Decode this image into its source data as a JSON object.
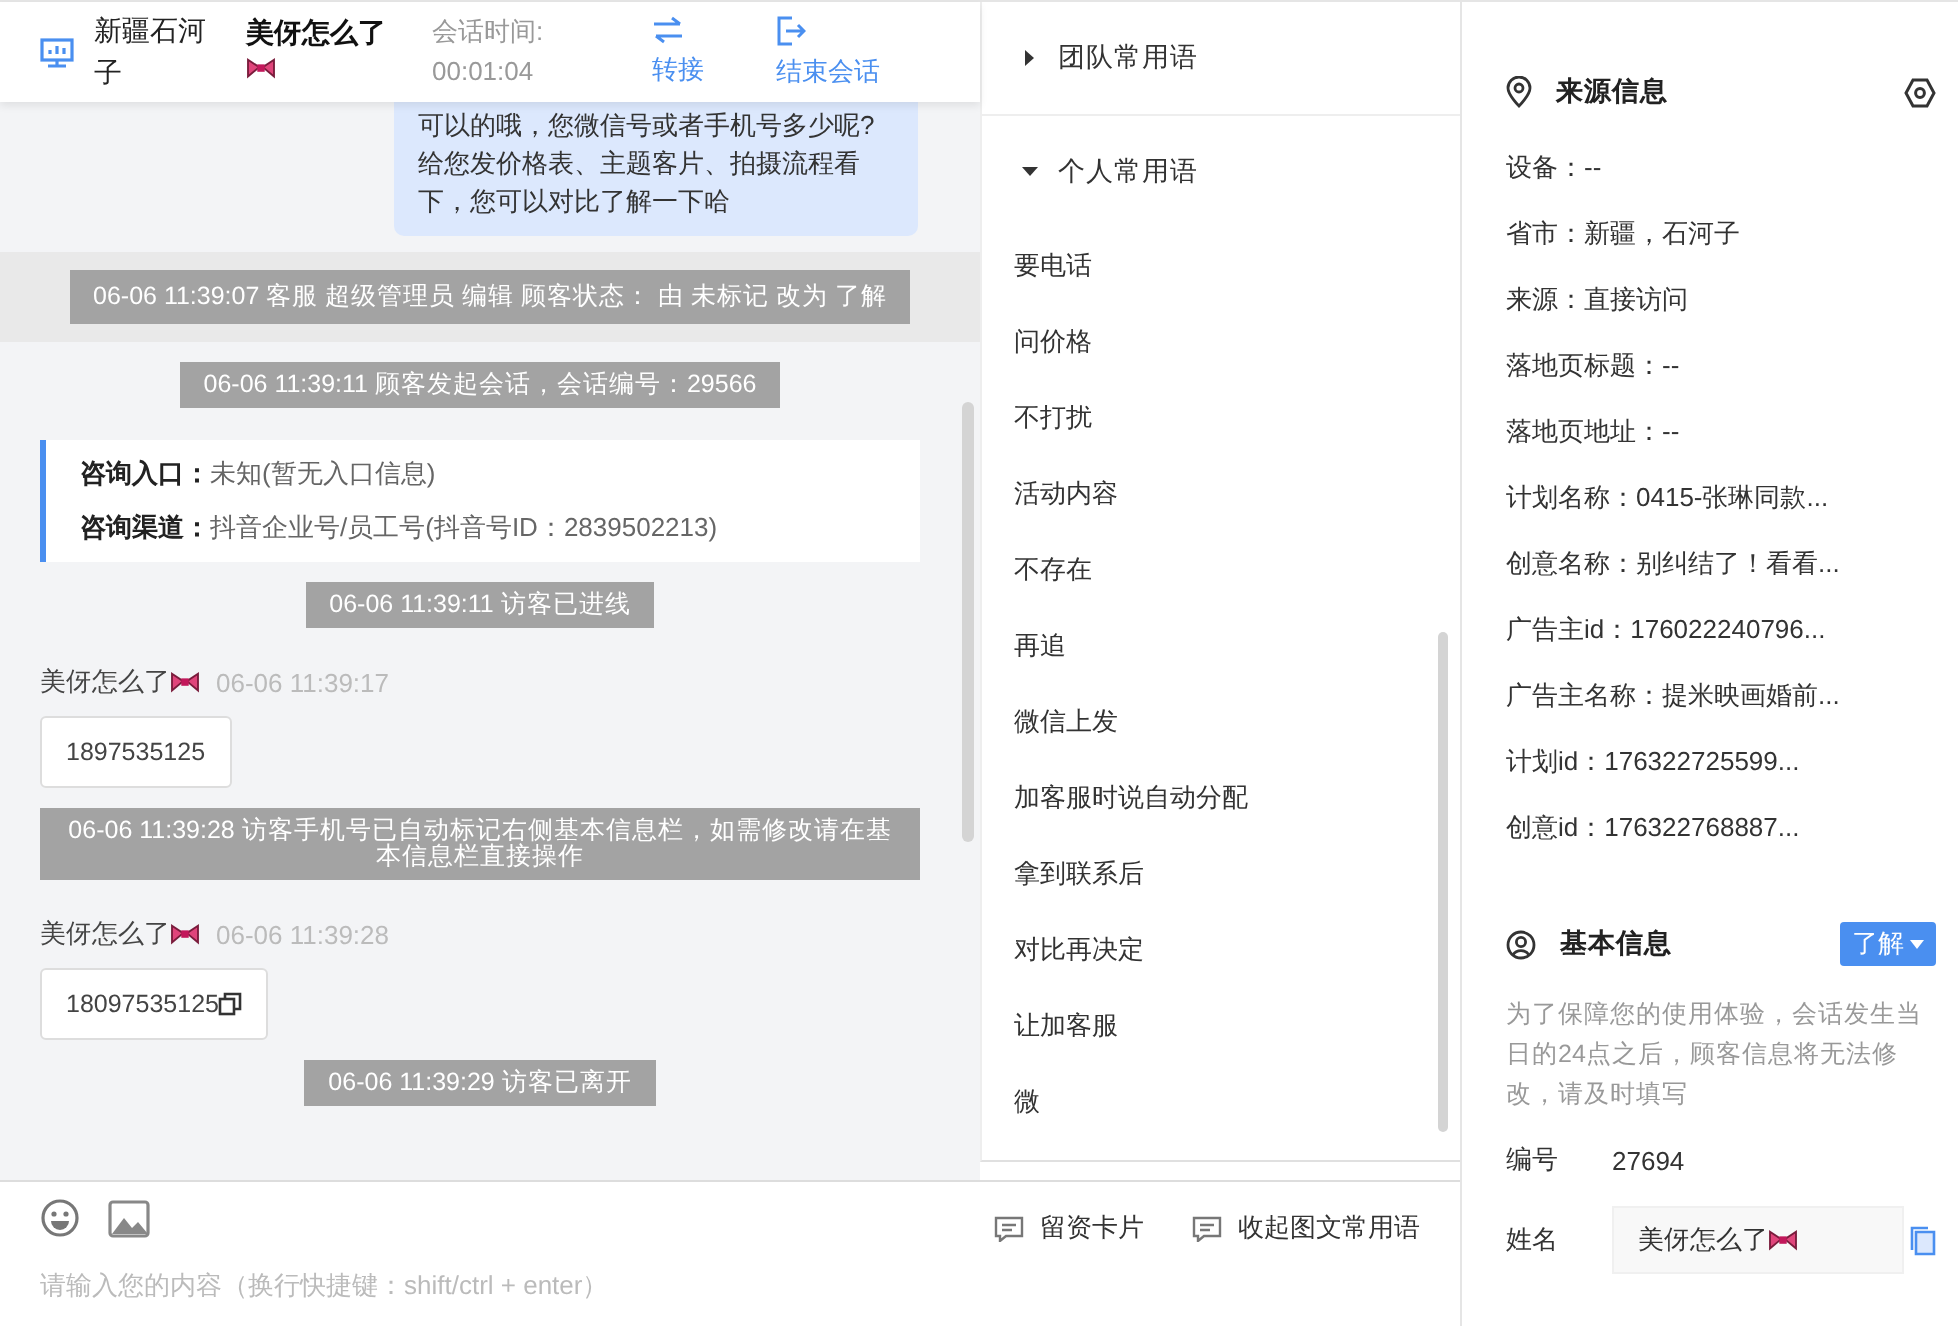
{
  "header": {
    "location": "新疆石河子",
    "visitor_name": "美伢怎么了",
    "session_time_label": "会话时间:",
    "session_time": "00:01:04",
    "actions": [
      {
        "kind": "transfer",
        "label": "转接"
      },
      {
        "kind": "end",
        "label": "结束会话"
      }
    ]
  },
  "messages": [
    {
      "kind": "agent",
      "text": "可以的哦，您微信号或者手机号多少呢?给您发价格表、主题客片、拍摄流程看下，您可以对比了解一下哈"
    },
    {
      "kind": "system",
      "text": "06-06 11:39:07 客服 超级管理员 编辑 顾客状态： 由 未标记 改为 了解",
      "highlighted": true
    },
    {
      "kind": "system",
      "text": "06-06 11:39:11 顾客发起会话，会话编号：29566",
      "highlighted": false
    },
    {
      "kind": "info",
      "rows": [
        {
          "label": "咨询入口：",
          "value": "未知(暂无入口信息)"
        },
        {
          "label": "咨询渠道：",
          "value": "抖音企业号/员工号(抖音号ID：2839502213)"
        }
      ]
    },
    {
      "kind": "system",
      "text": "06-06 11:39:11 访客已进线",
      "highlighted": false
    },
    {
      "kind": "visitor",
      "name": "美伢怎么了",
      "time": "06-06 11:39:17",
      "text": "1897535125",
      "copyable": false
    },
    {
      "kind": "system",
      "text": "06-06 11:39:28 访客手机号已自动标记右侧基本信息栏，如需修改请在基本信息栏直接操作",
      "highlighted": false
    },
    {
      "kind": "visitor",
      "name": "美伢怎么了",
      "time": "06-06 11:39:28",
      "text": "18097535125",
      "copyable": true
    },
    {
      "kind": "system",
      "text": "06-06 11:39:29 访客已离开",
      "highlighted": false
    }
  ],
  "input": {
    "placeholder": "请输入您的内容（换行快捷键：shift/ctrl + enter）"
  },
  "toolbar_actions": [
    "留资卡片",
    "收起图文常用语"
  ],
  "phrases": {
    "groups": [
      {
        "title": "团队常用语",
        "expanded": false
      },
      {
        "title": "个人常用语",
        "expanded": true
      }
    ],
    "items": [
      "要电话",
      "问价格",
      "不打扰",
      "活动内容",
      "不存在",
      "再追",
      "微信上发",
      "加客服时说自动分配",
      "拿到联系后",
      "对比再决定",
      "让加客服",
      "微"
    ]
  },
  "source_info": {
    "title": "来源信息",
    "rows": [
      "设备：--",
      "省市：新疆，石河子",
      "来源：直接访问",
      "落地页标题：--",
      "落地页地址：--",
      "计划名称：0415-张琳同款...",
      "创意名称：别纠结了！看看...",
      "广告主id：176022240796...",
      "广告主名称：提米映画婚前...",
      "计划id：176322725599...",
      "创意id：176322768887..."
    ]
  },
  "basic_info": {
    "title": "基本信息",
    "status": "了解",
    "notice": "为了保障您的使用体验，会话发生当日的24点之后，顾客信息将无法修改，请及时填写",
    "fields": [
      {
        "kind": "text",
        "label": "编号",
        "value": "27694"
      },
      {
        "kind": "input",
        "label": "姓名",
        "value": "美伢怎么了"
      }
    ]
  }
}
